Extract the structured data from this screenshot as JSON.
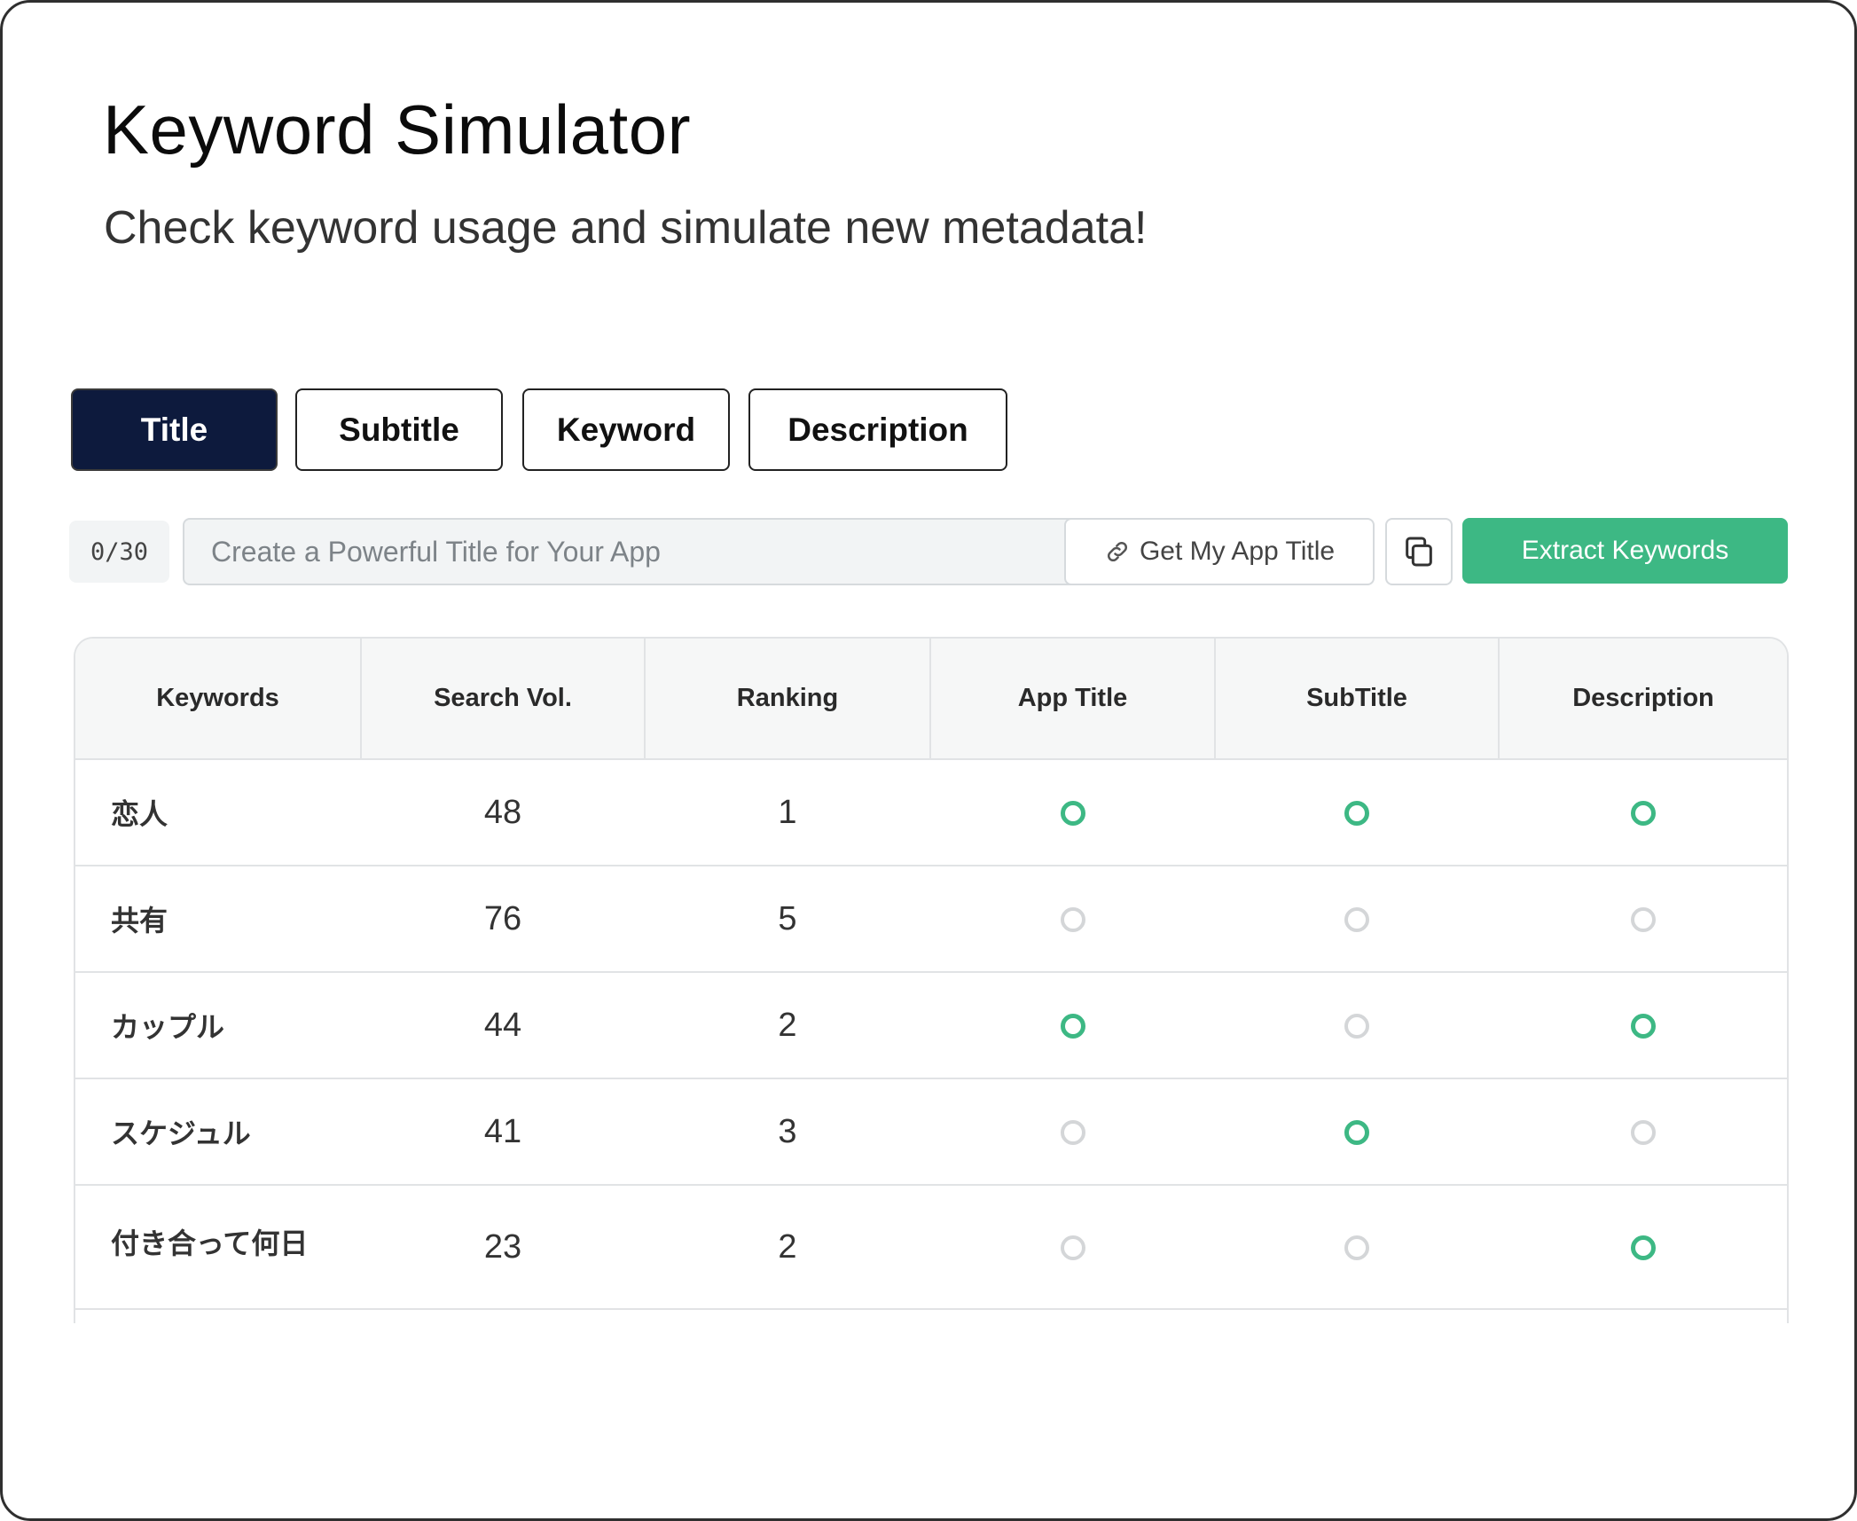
{
  "header": {
    "title": "Keyword Simulator",
    "subtitle": "Check keyword usage and simulate new metadata!"
  },
  "tabs": [
    {
      "label": "Title",
      "active": true
    },
    {
      "label": "Subtitle",
      "active": false
    },
    {
      "label": "Keyword",
      "active": false
    },
    {
      "label": "Description",
      "active": false
    }
  ],
  "editor": {
    "counter": "0/30",
    "input_placeholder": "Create a Powerful Title for Your App",
    "input_value": "",
    "get_title_label": "Get My App Title",
    "get_title_icon": "link-icon",
    "copy_icon": "copy-icon",
    "extract_label": "Extract Keywords"
  },
  "colors": {
    "accent_green": "#3db884",
    "active_tab": "#0d1a3d",
    "inactive_circle": "#d4d6d8"
  },
  "table": {
    "columns": [
      "Keywords",
      "Search Vol.",
      "Ranking",
      "App Title",
      "SubTitle",
      "Description"
    ],
    "rows": [
      {
        "keyword": "恋人",
        "volume": "48",
        "ranking": "1",
        "app_title": true,
        "subtitle": true,
        "description": true
      },
      {
        "keyword": "共有",
        "volume": "76",
        "ranking": "5",
        "app_title": false,
        "subtitle": false,
        "description": false
      },
      {
        "keyword": "カップル",
        "volume": "44",
        "ranking": "2",
        "app_title": true,
        "subtitle": false,
        "description": true
      },
      {
        "keyword": "スケジュル",
        "volume": "41",
        "ranking": "3",
        "app_title": false,
        "subtitle": true,
        "description": false
      },
      {
        "keyword": "付き合って何日",
        "volume": "23",
        "ranking": "2",
        "app_title": false,
        "subtitle": false,
        "description": true
      }
    ]
  }
}
